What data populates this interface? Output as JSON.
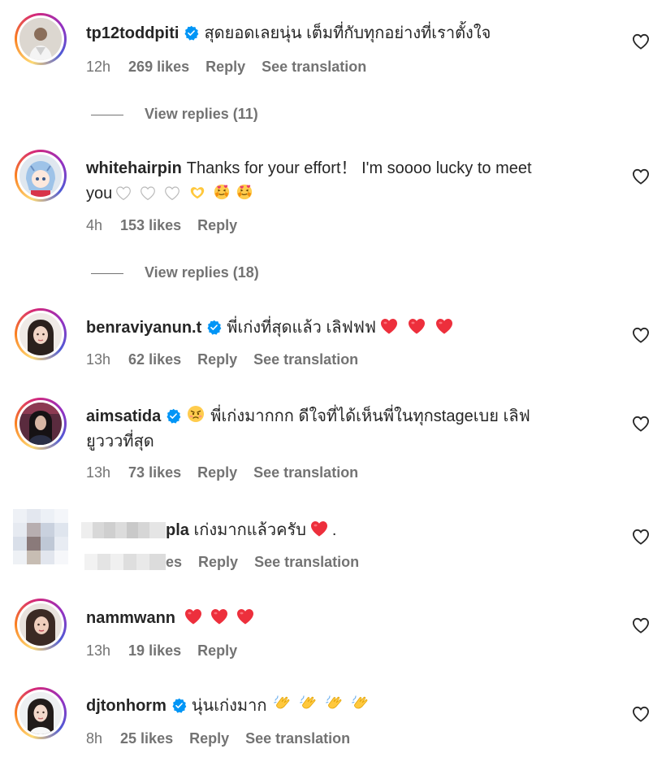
{
  "comments": [
    {
      "username": "tp12toddpiti",
      "verified": true,
      "text": "สุดยอดเลยนุ่น เต็มที่กับทุกอย่างที่เราตั้งใจ",
      "time": "12h",
      "likes": "269 likes",
      "reply": "Reply",
      "translate": "See translation",
      "view_replies": "View replies (11)"
    },
    {
      "username": "whitehairpin",
      "verified": false,
      "text": "Thanks for your effort！ I'm soooo lucky to meet",
      "text2": "you",
      "time": "4h",
      "likes": "153 likes",
      "reply": "Reply",
      "view_replies": "View replies (18)"
    },
    {
      "username": "benraviyanun.t",
      "verified": true,
      "text": "พี่เก่งที่สุดแล้ว เลิฟฟฟ",
      "time": "13h",
      "likes": "62 likes",
      "reply": "Reply",
      "translate": "See translation"
    },
    {
      "username": "aimsatida",
      "verified": true,
      "text": "พี่เก่งมากกก ดีใจที่ได้เห็นพี่ในทุกstageเบย เลิฟ",
      "text2": "ยูวววที่สุด",
      "time": "13h",
      "likes": "73 likes",
      "reply": "Reply",
      "translate": "See translation"
    },
    {
      "username_partial": "pla",
      "text": "เก่งมากแล้วครับ",
      "text_tail": ".",
      "likes_partial": "es",
      "reply": "Reply",
      "translate": "See translation"
    },
    {
      "username": "nammwann",
      "verified": false,
      "time": "13h",
      "likes": "19 likes",
      "reply": "Reply"
    },
    {
      "username": "djtonhorm",
      "verified": true,
      "text": "นุ่นเก่งมาก",
      "time": "8h",
      "likes": "25 likes",
      "reply": "Reply",
      "translate": "See translation"
    }
  ],
  "colors": {
    "verified": "#0095f6",
    "heart_red": "#ed2f3c",
    "meta": "#737373",
    "text": "#262626"
  }
}
